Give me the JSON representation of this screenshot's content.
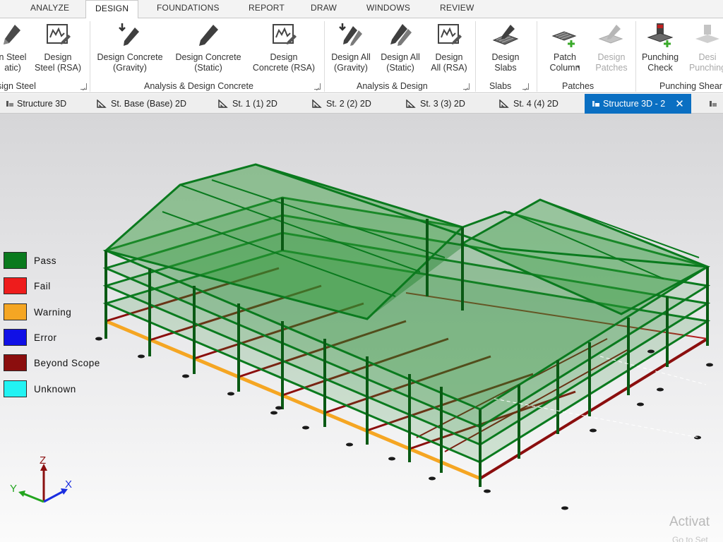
{
  "ribbon_tabs": [
    "ANALYZE",
    "DESIGN",
    "FOUNDATIONS",
    "REPORT",
    "DRAW",
    "WINDOWS",
    "REVIEW"
  ],
  "active_ribbon_tab": "DESIGN",
  "tools": [
    {
      "id": "design-steel-static",
      "label": "n Steel\natic)",
      "icon": "design-steel-icon"
    },
    {
      "id": "design-steel-rsa",
      "label": "Design\nSteel (RSA)",
      "icon": "response-spectrum-icon"
    },
    {
      "id": "design-concrete-gravity",
      "label": "Design Concrete\n(Gravity)",
      "icon": "pencil-down-arrow-icon"
    },
    {
      "id": "design-concrete-static",
      "label": "Design Concrete\n(Static)",
      "icon": "pencil-icon"
    },
    {
      "id": "design-concrete-rsa",
      "label": "Design\nConcrete (RSA)",
      "icon": "response-spectrum-icon"
    },
    {
      "id": "design-all-gravity",
      "label": "Design All\n(Gravity)",
      "icon": "pencil-pair-arrow-icon"
    },
    {
      "id": "design-all-static",
      "label": "Design All\n(Static)",
      "icon": "pencil-pair-icon"
    },
    {
      "id": "design-all-rsa",
      "label": "Design\nAll (RSA)",
      "icon": "response-spectrum-icon"
    },
    {
      "id": "design-slabs",
      "label": "Design\nSlabs",
      "icon": "slab-pencil-icon"
    },
    {
      "id": "patch-column",
      "label": "Patch\nColumn",
      "icon": "patch-plus-icon"
    },
    {
      "id": "design-patches",
      "label": "Design\nPatches",
      "icon": "patch-pencil-icon"
    },
    {
      "id": "punching-check",
      "label": "Punching\nCheck",
      "icon": "punching-plus-icon"
    },
    {
      "id": "design-punching",
      "label": "Desi\nPunching",
      "icon": "punching-pencil-icon"
    }
  ],
  "groups": [
    "sign Steel",
    "Analysis & Design Concrete",
    "Analysis & Design",
    "Slabs",
    "Patches",
    "Punching Shear"
  ],
  "view_tabs": [
    "Structure 3D",
    "St. Base (Base) 2D",
    "St. 1 (1) 2D",
    "St. 2 (2) 2D",
    "St. 3 (3) 2D",
    "St. 4 (4) 2D",
    "Structure 3D - 2"
  ],
  "active_view_tab": "Structure 3D - 2",
  "close_glyph": "✕",
  "legend": [
    {
      "label": "Pass",
      "color": "#0a7a1e"
    },
    {
      "label": "Fail",
      "color": "#ee1c1c"
    },
    {
      "label": "Warning",
      "color": "#f5a623"
    },
    {
      "label": "Error",
      "color": "#1010e6"
    },
    {
      "label": "Beyond Scope",
      "color": "#8b0e0e"
    },
    {
      "label": "Unknown",
      "color": "#22f3f3"
    }
  ],
  "axes": {
    "x": "X",
    "y": "Y",
    "z": "Z",
    "x_color": "#1a2ee0",
    "y_color": "#23a51f",
    "z_color": "#8b1010"
  },
  "status_colors": {
    "pass": "#0a7a1e",
    "beyond_scope": "#8b0e0e",
    "warning": "#f5a623"
  },
  "watermark": {
    "line1": "Activat",
    "line2": "Go to Set"
  }
}
